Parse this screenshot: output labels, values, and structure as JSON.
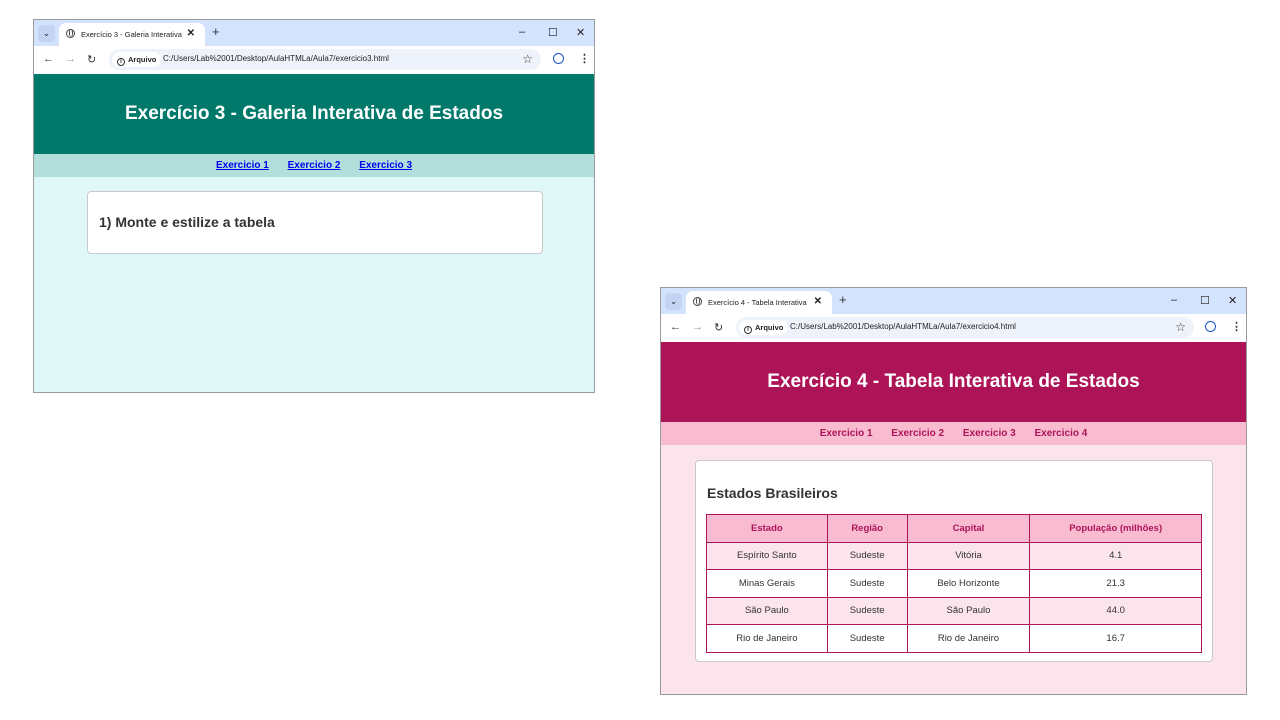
{
  "windows": [
    {
      "tab_title": "Exercício 3 - Galeria Interativa",
      "address_chip": "Arquivo",
      "url": "C:/Users/Lab%2001/Desktop/AulaHTMLa/Aula7/exercicio3.html",
      "header_title": "Exercício 3 - Galeria Interativa de Estados",
      "nav_links": [
        "Exercicio 1",
        "Exercicio 2",
        "Exercicio 3"
      ],
      "card_heading": "1) Monte e estilize a tabela"
    },
    {
      "tab_title": "Exercício 4 - Tabela Interativa",
      "address_chip": "Arquivo",
      "url": "C:/Users/Lab%2001/Desktop/AulaHTMLa/Aula7/exercicio4.html",
      "header_title": "Exercício 4 - Tabela Interativa de Estados",
      "nav_links": [
        "Exercicio 1",
        "Exercicio 2",
        "Exercicio 3",
        "Exercicio 4"
      ],
      "card_heading": "Estados Brasileiros",
      "table": {
        "columns": [
          "Estado",
          "Região",
          "Capital",
          "População (milhões)"
        ],
        "rows": [
          [
            "Espírito Santo",
            "Sudeste",
            "Vitória",
            "4.1"
          ],
          [
            "Minas Gerais",
            "Sudeste",
            "Belo Horizonte",
            "21.3"
          ],
          [
            "São Paulo",
            "Sudeste",
            "São Paulo",
            "44.0"
          ],
          [
            "Rio de Janeiro",
            "Sudeste",
            "Rio de Janeiro",
            "16.7"
          ]
        ]
      }
    }
  ],
  "browser_icons": {
    "tab_menu": "chevron-down-icon",
    "tab_close": "close-icon",
    "new_tab": "plus-icon",
    "minimize": "minimize-icon",
    "maximize": "maximize-icon",
    "close": "close-icon",
    "back": "arrow-left-icon",
    "forward": "arrow-right-icon",
    "reload": "reload-icon",
    "info": "info-icon",
    "bookmark": "star-icon",
    "profile": "profile-icon",
    "menu": "kebab-menu-icon"
  },
  "colors": {
    "ex3_header": "#00796b",
    "ex3_nav": "#b2dfdb",
    "ex3_page": "#e0f7f8",
    "ex4_header": "#ad1457",
    "ex4_nav": "#f8bbd0",
    "ex4_page": "#fce4ec",
    "browser_tabbar": "#d3e3fd"
  }
}
